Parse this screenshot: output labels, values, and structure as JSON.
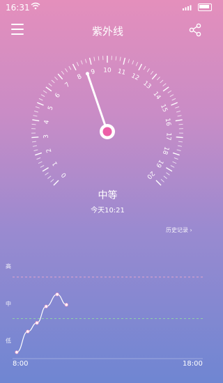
{
  "status_bar": {
    "time": "16:31"
  },
  "header": {
    "title": "紫外线"
  },
  "gauge": {
    "value": 8.6,
    "min": 0,
    "max": 20,
    "tick_labels": [
      "0",
      "1",
      "2",
      "3",
      "4",
      "5",
      "6",
      "7",
      "8",
      "9",
      "10",
      "11",
      "12",
      "13",
      "14",
      "15",
      "16",
      "17",
      "18",
      "19",
      "20"
    ],
    "level_text": "中等",
    "updated_text": "今天10:21"
  },
  "history": {
    "link_text": "历史记录",
    "chevron": "chevron-right-icon"
  },
  "chart_data": {
    "type": "line",
    "y_levels": [
      "高",
      "中",
      "低"
    ],
    "x_range_labels": [
      "8:00",
      "18:00"
    ],
    "x": [
      8.0,
      8.6,
      9.1,
      9.6,
      10.2,
      10.7
    ],
    "y": [
      0.05,
      0.29,
      0.39,
      0.58,
      0.72,
      0.6
    ],
    "ylim": [
      0,
      1
    ],
    "reference_lines": [
      {
        "y": 0.92,
        "color": "#e6a4cc",
        "style": "dashed"
      },
      {
        "y": 0.44,
        "color": "#8fd0a6",
        "style": "dashed"
      }
    ]
  },
  "colors": {
    "needle_dot": "#ec5fa8"
  }
}
